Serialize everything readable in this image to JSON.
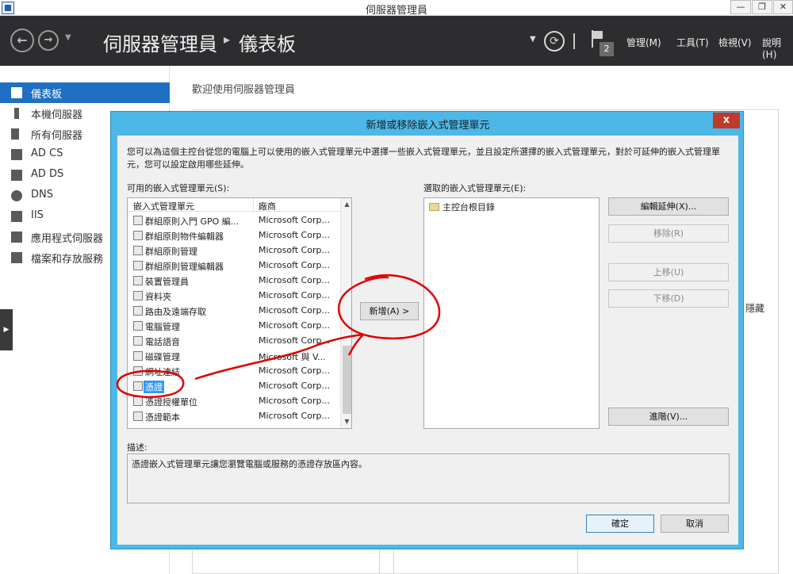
{
  "window": {
    "title": "伺服器管理員",
    "controls": {
      "minimize": "—",
      "restore": "❐",
      "close": "✕"
    }
  },
  "header": {
    "breadcrumb_root": "伺服器管理員",
    "separator": "▸",
    "breadcrumb_page": "儀表板",
    "notification_count": "2",
    "menus": [
      "管理(M)",
      "工具(T)",
      "檢視(V)",
      "說明(H)"
    ]
  },
  "sidebar": {
    "items": [
      {
        "label": "儀表板",
        "icon": "dashboard-icon",
        "active": true
      },
      {
        "label": "本機伺服器",
        "icon": "server-icon"
      },
      {
        "label": "所有伺服器",
        "icon": "servers-icon"
      },
      {
        "label": "AD CS",
        "icon": "adcs-icon"
      },
      {
        "label": "AD DS",
        "icon": "adds-icon"
      },
      {
        "label": "DNS",
        "icon": "dns-icon"
      },
      {
        "label": "IIS",
        "icon": "iis-icon"
      },
      {
        "label": "應用程式伺服器",
        "icon": "appserver-icon"
      },
      {
        "label": "檔案和存放服務",
        "icon": "storage-icon"
      }
    ]
  },
  "main": {
    "welcome": "歡迎使用伺服器管理員",
    "hide_link": "隱藏"
  },
  "dialog": {
    "title": "新增或移除嵌入式管理單元",
    "close": "x",
    "intro": "您可以為這個主控台從您的電腦上可以使用的嵌入式管理單元中選擇一些嵌入式管理單元，並且設定所選擇的嵌入式管理單元，對於可延伸的嵌入式管理單元，您可以設定啟用哪些延伸。",
    "available_label": "可用的嵌入式管理單元(S):",
    "selected_label": "選取的嵌入式管理單元(E):",
    "columns": [
      "嵌入式管理單元",
      "廠商"
    ],
    "rows": [
      {
        "name": "群組原則入門 GPO 編...",
        "vendor": "Microsoft Corp..."
      },
      {
        "name": "群組原則物件編輯器",
        "vendor": "Microsoft Corp..."
      },
      {
        "name": "群組原則管理",
        "vendor": "Microsoft Corp..."
      },
      {
        "name": "群組原則管理編輯器",
        "vendor": "Microsoft Corp..."
      },
      {
        "name": "裝置管理員",
        "vendor": "Microsoft Corp..."
      },
      {
        "name": "資料夾",
        "vendor": "Microsoft Corp..."
      },
      {
        "name": "路由及遠端存取",
        "vendor": "Microsoft Corp..."
      },
      {
        "name": "電腦管理",
        "vendor": "Microsoft Corp..."
      },
      {
        "name": "電話語音",
        "vendor": "Microsoft Corp..."
      },
      {
        "name": "磁碟管理",
        "vendor": "Microsoft 與 V..."
      },
      {
        "name": "網址連結",
        "vendor": "Microsoft Corp..."
      },
      {
        "name": "憑證",
        "vendor": "Microsoft Corp...",
        "selected": true
      },
      {
        "name": "憑證授權單位",
        "vendor": "Microsoft Corp..."
      },
      {
        "name": "憑證範本",
        "vendor": "Microsoft Corp..."
      }
    ],
    "add_button": "新增(A) >",
    "selected_items": [
      "主控台根目錄"
    ],
    "side_buttons": {
      "edit_extensions": "編輯延伸(X)...",
      "remove": "移除(R)",
      "move_up": "上移(U)",
      "move_down": "下移(D)",
      "advanced": "進階(V)..."
    },
    "description_label": "描述:",
    "description": "憑證嵌入式管理單元讓您瀏覽電腦或服務的憑證存放區內容。",
    "ok": "確定",
    "cancel": "取消"
  },
  "colors": {
    "header_bg": "#2d2d30",
    "accent": "#1f6fc2",
    "dialog_frame": "#4db8e8",
    "annotation": "#e00000"
  }
}
